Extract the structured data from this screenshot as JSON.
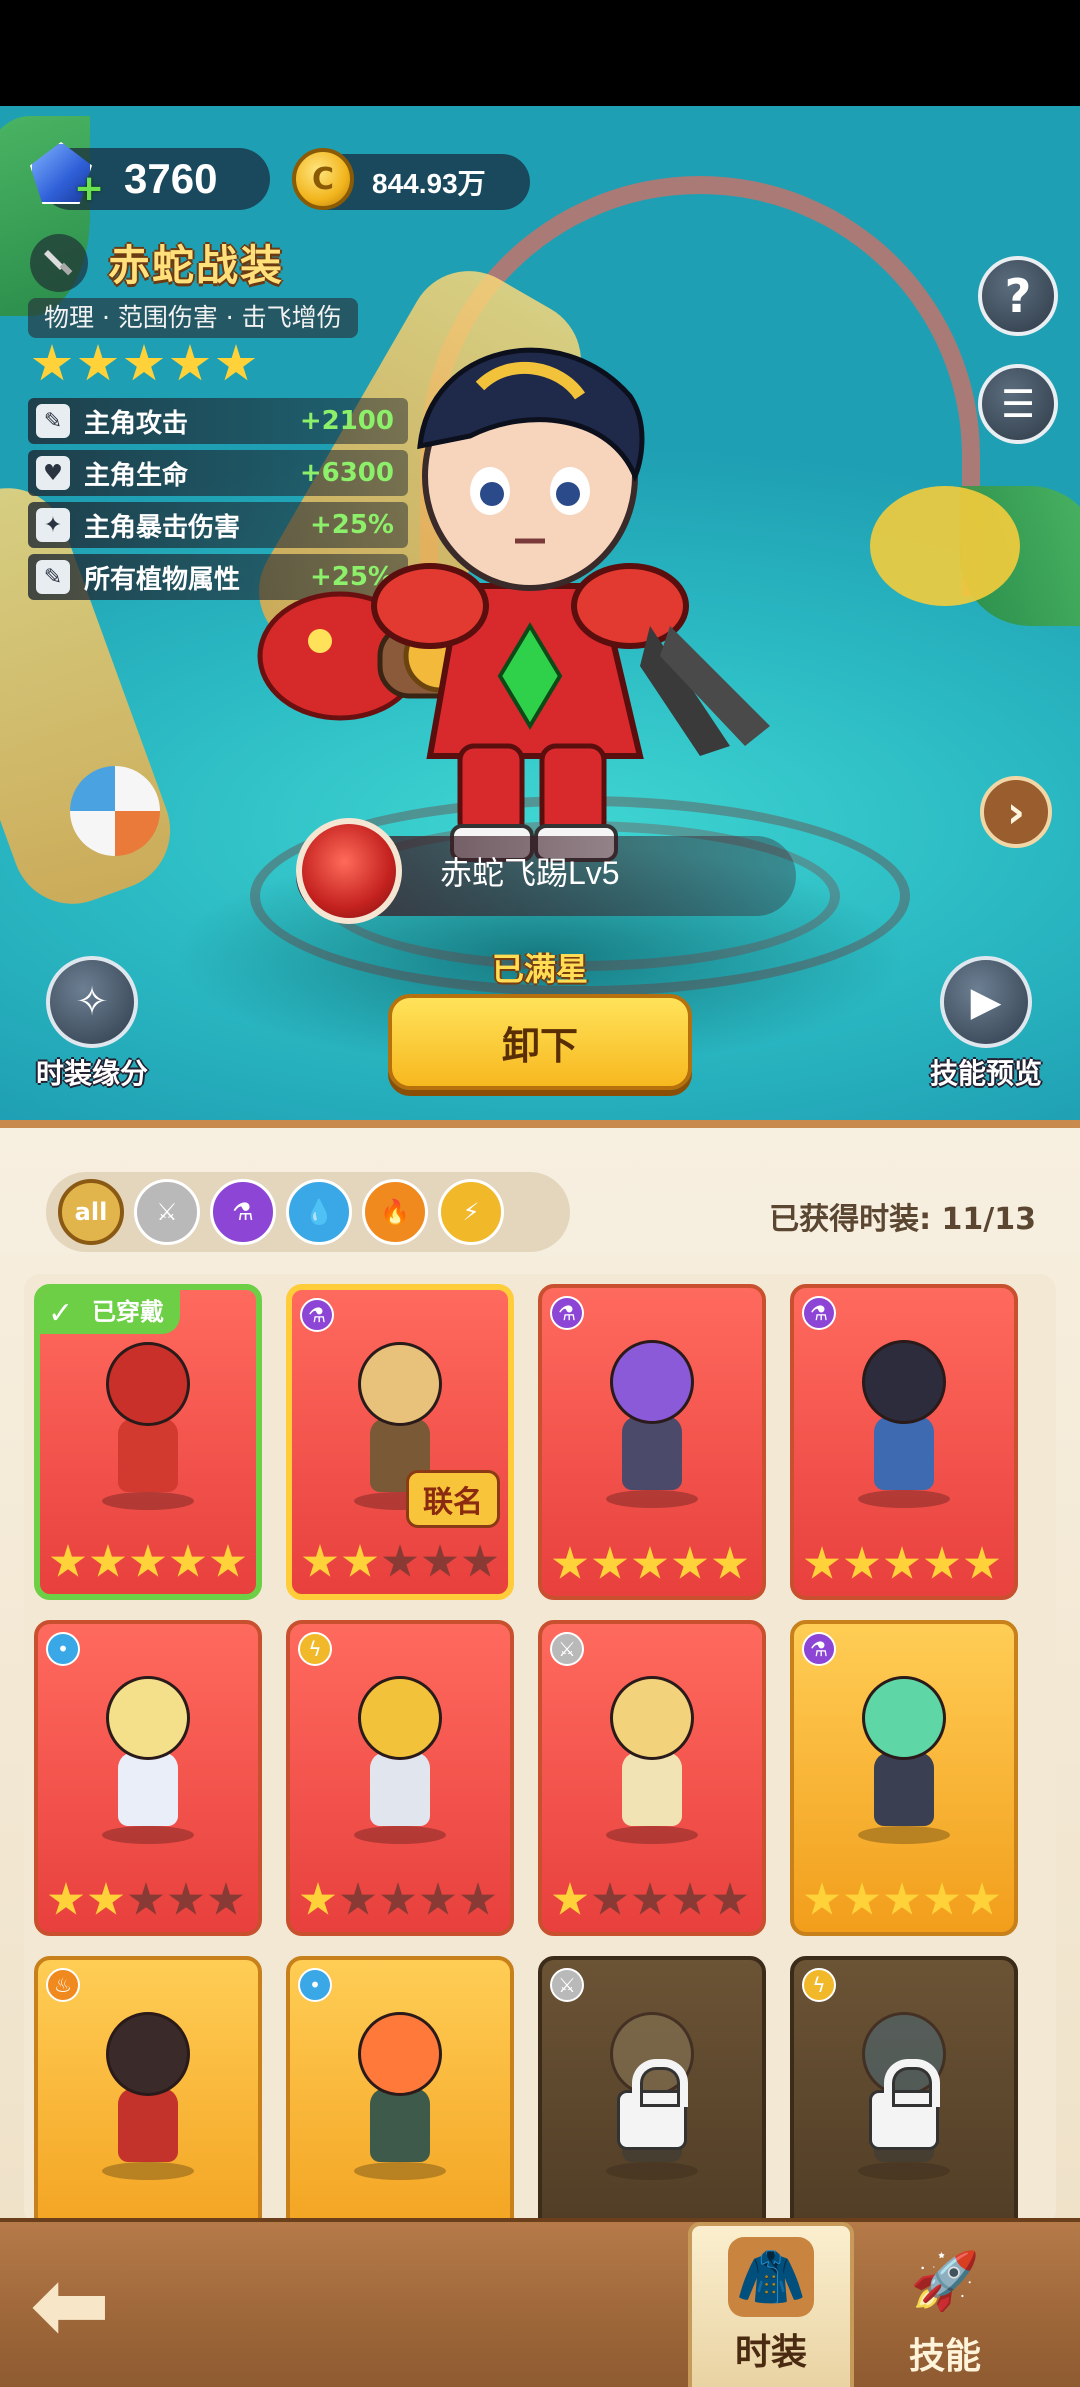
{
  "resources": {
    "gems": "3760",
    "coins": "844.93万"
  },
  "costume": {
    "name": "赤蛇战装",
    "tags": "物理 · 范围伤害 · 击飞增伤",
    "stars": 5,
    "stats": [
      {
        "icon": "syringe-icon",
        "label": "主角攻击",
        "value": "+2100"
      },
      {
        "icon": "heart-icon",
        "label": "主角生命",
        "value": "+6300"
      },
      {
        "icon": "crit-icon",
        "label": "主角暴击伤害",
        "value": "+25%"
      },
      {
        "icon": "syringe-icon",
        "label": "所有植物属性",
        "value": "+25%"
      }
    ],
    "skill": "赤蛇飞踢Lv5",
    "star_status": "已满星",
    "unequip_label": "卸下"
  },
  "side_buttons": {
    "help": "?",
    "list": "☰",
    "next": "›",
    "bond_label": "时装缘分",
    "preview_label": "技能预览"
  },
  "filters": [
    {
      "label": "all",
      "color": "#e2b54c"
    },
    {
      "label": "",
      "color": "#b9b9b9",
      "icon": "sword-icon"
    },
    {
      "label": "",
      "color": "#8d45d6",
      "icon": "potion-icon"
    },
    {
      "label": "",
      "color": "#3aa7e6",
      "icon": "water-icon"
    },
    {
      "label": "",
      "color": "#f08a1e",
      "icon": "fire-icon"
    },
    {
      "label": "",
      "color": "#f1b82a",
      "icon": "lightning-icon"
    }
  ],
  "owned_count": "已获得时装: 11/13",
  "equipped_label": "已穿戴",
  "collab_label": "联名",
  "cards": [
    {
      "style": "red",
      "element": "sword",
      "stars": 5,
      "equipped": true,
      "head": "#c9302a",
      "body": "#d23a2f"
    },
    {
      "style": "red",
      "element": "potion",
      "stars": 2,
      "collab": true,
      "head": "#e8c27a",
      "body": "#7a5a36"
    },
    {
      "style": "red",
      "element": "potion",
      "stars": 5,
      "head": "#8a5ad8",
      "body": "#4b4a6a"
    },
    {
      "style": "red",
      "element": "potion",
      "stars": 5,
      "head": "#2c2c3c",
      "body": "#3d6ab0"
    },
    {
      "style": "red",
      "element": "water",
      "stars": 2,
      "head": "#f4e08a",
      "body": "#e9eef8"
    },
    {
      "style": "red",
      "element": "lightning",
      "stars": 1,
      "head": "#f2c23a",
      "body": "#e1e6ee"
    },
    {
      "style": "red",
      "element": "sword",
      "stars": 1,
      "head": "#f2d27a",
      "body": "#f1e3b4"
    },
    {
      "style": "gold",
      "element": "potion",
      "stars": 5,
      "head": "#5fd6a5",
      "body": "#3a3f52"
    },
    {
      "style": "gold",
      "element": "fire",
      "stars": 0,
      "head": "#3a2a2a",
      "body": "#c3332b"
    },
    {
      "style": "gold",
      "element": "water",
      "stars": 0,
      "head": "#ff7a3a",
      "body": "#3d5a4a"
    },
    {
      "style": "dark",
      "element": "sword",
      "stars": 0,
      "locked": true,
      "head": "#8a7a5a",
      "body": "#3a3a3a"
    },
    {
      "style": "dark",
      "element": "lightning",
      "stars": 0,
      "locked": true,
      "head": "#4a6a7a",
      "body": "#3a3a3a"
    }
  ],
  "nav": {
    "back": "⬅",
    "costume_tab": "时装",
    "skill_tab": "技能"
  },
  "colors": {
    "accent_gold": "#ffd23a",
    "stat_green": "#8df06a",
    "equipped_green": "#6ccf45"
  }
}
